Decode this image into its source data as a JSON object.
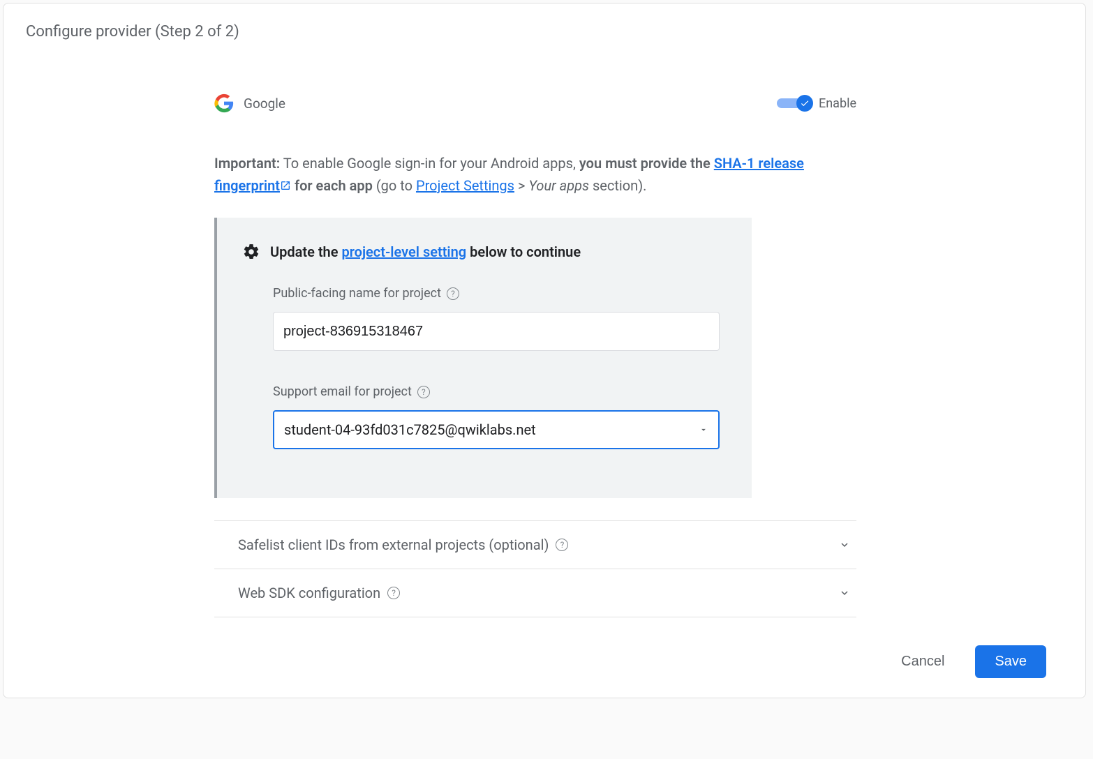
{
  "dialog_title": "Configure provider (Step 2 of 2)",
  "provider": {
    "name": "Google"
  },
  "toggle": {
    "label": "Enable"
  },
  "important": {
    "label": "Important:",
    "text1": " To enable Google sign-in for your Android apps, ",
    "bold1": "you must provide the ",
    "link1": "SHA-1 release fingerprint",
    "bold2": " for each app",
    "text2": " (go to ",
    "link2": "Project Settings",
    "text3": " > ",
    "italic1": "Your apps",
    "text4": " section)."
  },
  "card": {
    "title_prefix": "Update the ",
    "title_link": "project-level setting",
    "title_suffix": " below to continue",
    "public_name_label": "Public-facing name for project",
    "public_name_value": "project-836915318467",
    "support_email_label": "Support email for project",
    "support_email_value": "student-04-93fd031c7825@qwiklabs.net"
  },
  "expanders": {
    "safelist": "Safelist client IDs from external projects (optional)",
    "websdk": "Web SDK configuration"
  },
  "buttons": {
    "cancel": "Cancel",
    "save": "Save"
  }
}
